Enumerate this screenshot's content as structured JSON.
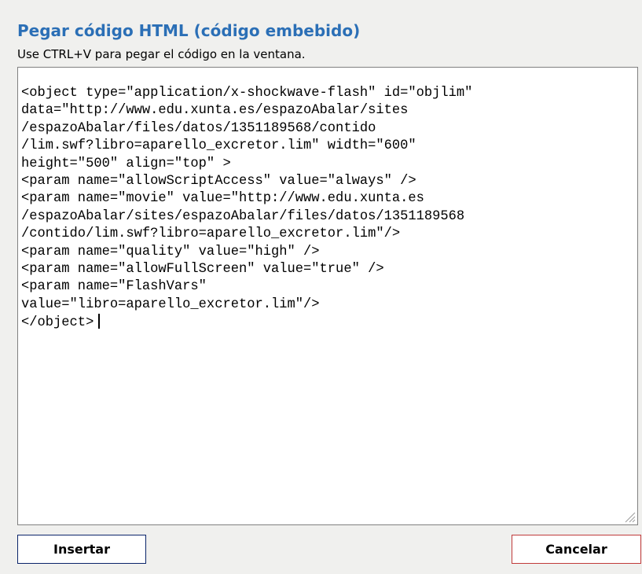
{
  "dialog": {
    "title": "Pegar código HTML (código embebido)",
    "instructions": "Use CTRL+V para pegar el código en la ventana.",
    "embed_code": "<object type=\"application/x-shockwave-flash\" id=\"objlim\"\ndata=\"http://www.edu.xunta.es/espazoAbalar/sites\n/espazoAbalar/files/datos/1351189568/contido\n/lim.swf?libro=aparello_excretor.lim\" width=\"600\"\nheight=\"500\" align=\"top\" >\n<param name=\"allowScriptAccess\" value=\"always\" />\n<param name=\"movie\" value=\"http://www.edu.xunta.es\n/espazoAbalar/sites/espazoAbalar/files/datos/1351189568\n/contido/lim.swf?libro=aparello_excretor.lim\"/>\n<param name=\"quality\" value=\"high\" />\n<param name=\"allowFullScreen\" value=\"true\" />\n<param name=\"FlashVars\"\nvalue=\"libro=aparello_excretor.lim\"/>\n</object>",
    "insert_label": "Insertar",
    "cancel_label": "Cancelar"
  },
  "colors": {
    "title": "#2b6fb6",
    "background": "#f0f0ee",
    "insert_border": "#0a246a",
    "cancel_border": "#c03a3a"
  },
  "icons": {
    "resize_grip": "resize-grip-icon"
  }
}
